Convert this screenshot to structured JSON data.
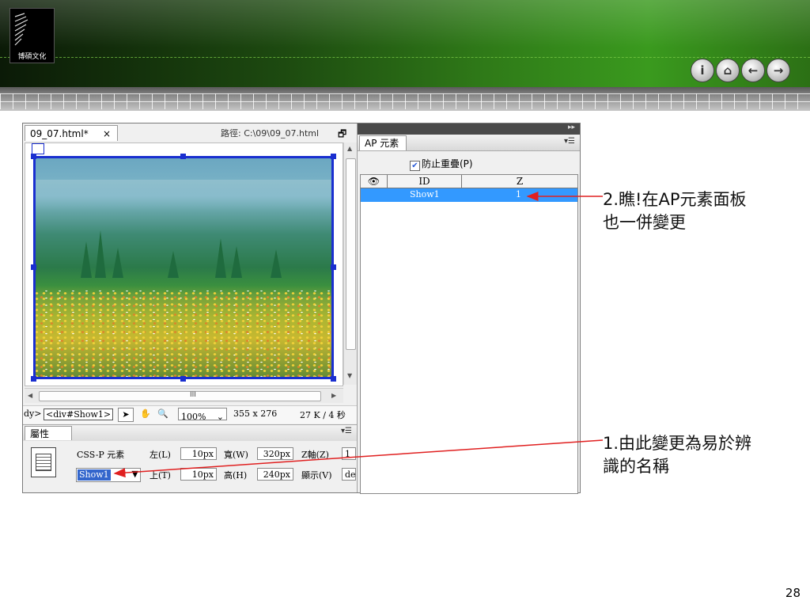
{
  "slide": {
    "logo_text": "博碩文化",
    "page_number": "28",
    "nav_buttons": [
      "info-icon",
      "home-icon",
      "back-arrow-icon",
      "forward-arrow-icon"
    ]
  },
  "document": {
    "tab_label": "09_07.html*",
    "tab_close": "×",
    "path_label": "路徑:",
    "path_value": "C:\\09\\09_07.html",
    "scroll_grip": "III"
  },
  "statusbar": {
    "tag_prefix": "dy>",
    "tag_selected": "<div#Show1>",
    "zoom_value": "100%",
    "dimensions": "355 x 276",
    "size_info": "27 K / 4 秒"
  },
  "properties": {
    "tab_label": "屬性",
    "type_label": "CSS-P 元素",
    "id_value": "Show1",
    "left_label": "左(L)",
    "left_value": "10px",
    "top_label": "上(T)",
    "top_value": "10px",
    "width_label": "寬(W)",
    "width_value": "320px",
    "height_label": "高(H)",
    "height_value": "240px",
    "z_label": "Z軸(Z)",
    "z_value": "1",
    "vis_label": "顯示(V)",
    "vis_value": "de"
  },
  "ap_panel": {
    "tab_label": "AP 元素",
    "prevent_overlap_label": "防止重疊(P)",
    "prevent_overlap_checked": true,
    "columns": [
      "",
      "ID",
      "Z"
    ],
    "rows": [
      {
        "id": "Show1",
        "z": "1"
      }
    ]
  },
  "callouts": {
    "callout_1_line1": "1.由此變更為易於辨",
    "callout_1_line2": "識的名稱",
    "callout_2_line1": "2.瞧!在AP元素面板",
    "callout_2_line2": "也一併變更"
  },
  "colors": {
    "selection_border": "#1a2fd0",
    "row_highlight": "#3399ff",
    "arrow": "#e02020"
  }
}
